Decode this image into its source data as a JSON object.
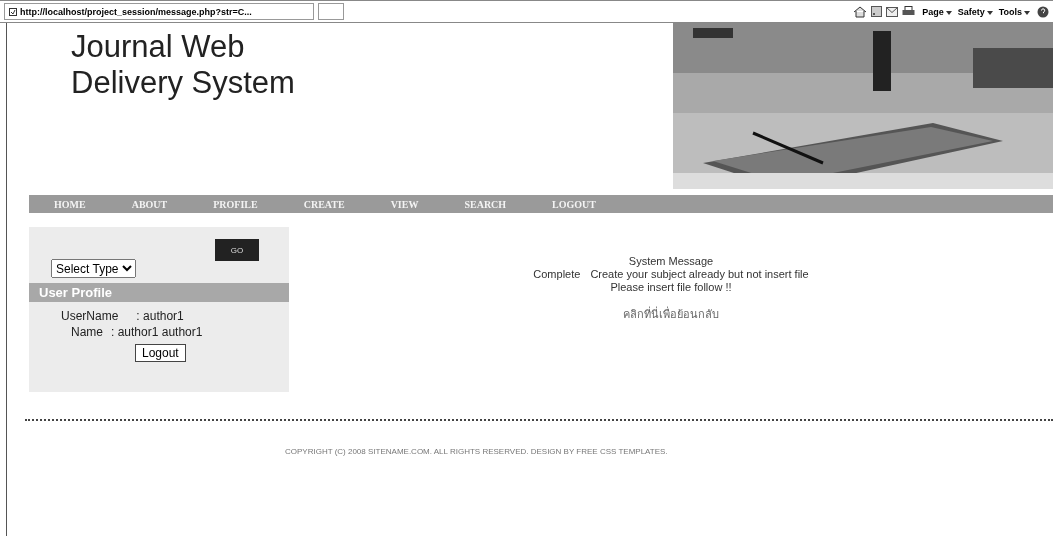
{
  "browser": {
    "address": "http://localhost/project_session/message.php?str=C...",
    "menus": [
      "Page",
      "Safety",
      "Tools"
    ]
  },
  "site": {
    "title_lines": [
      "Journal Web",
      "Delivery System"
    ]
  },
  "nav": [
    "HOME",
    "ABOUT",
    "PROFILE",
    "CREATE",
    "VIEW",
    "SEARCH",
    "LOGOUT"
  ],
  "sidebar": {
    "search_button": "GO",
    "type_select": "Select Type",
    "profile_heading": "User Profile",
    "fields": [
      {
        "label": "UserName",
        "value": ": author1"
      },
      {
        "label": "Name",
        "value": ": author1 author1"
      }
    ],
    "logout_button": "Logout"
  },
  "message": {
    "heading": "System Message",
    "status": "Complete",
    "text": "Create your subject already but not insert file",
    "line2": "Please insert file follow !!",
    "back_link": "คลิกที่นี่เพื่อย้อนกลับ"
  },
  "footer": "COPYRIGHT (C) 2008 SITENAME.COM. ALL RIGHTS RESERVED. DESIGN BY FREE CSS TEMPLATES."
}
